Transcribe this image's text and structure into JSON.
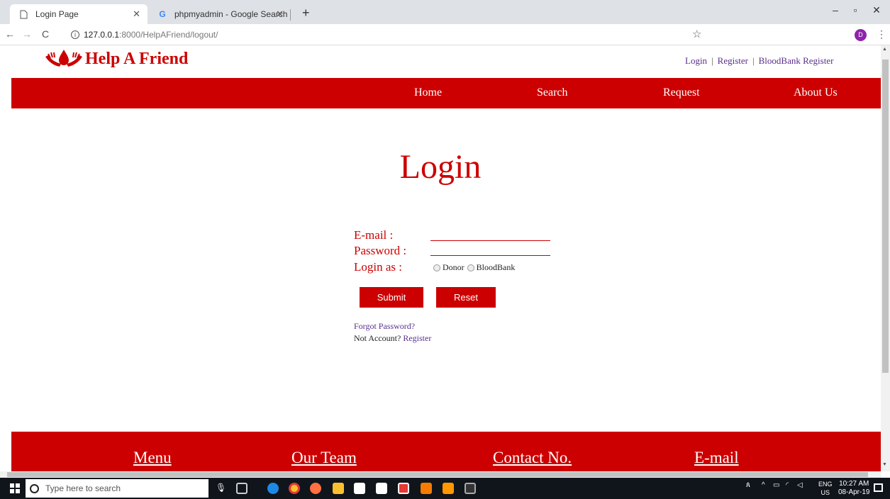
{
  "browser": {
    "tabs": [
      {
        "title": "Login Page",
        "active": true
      },
      {
        "title": "phpmyadmin - Google Search",
        "active": false
      }
    ],
    "url_host": "127.0.0.1",
    "url_path": ":8000/HelpAFriend/logout/",
    "profile_initial": "D"
  },
  "site": {
    "logo_text": "Help A Friend",
    "top_links": [
      "Login",
      "Register",
      "BloodBank Register"
    ],
    "nav": [
      "Home",
      "Search",
      "Request",
      "About Us"
    ]
  },
  "login": {
    "title": "Login",
    "email_label": "E-mail :",
    "password_label": "Password :",
    "login_as_label": "Login as :",
    "roles": [
      "Donor",
      "BloodBank"
    ],
    "submit_label": "Submit",
    "reset_label": "Reset",
    "forgot_label": "Forgot Password?",
    "no_account_text": "Not Account?",
    "register_link": "Register"
  },
  "footer": {
    "links": [
      "Menu",
      "Our Team",
      "Contact No.",
      "E-mail"
    ]
  },
  "taskbar": {
    "search_placeholder": "Type here to search",
    "lang": "ENG",
    "region": "US",
    "time": "10:27 AM",
    "date": "08-Apr-19"
  },
  "colors": {
    "brand_red": "#cc0000",
    "link_purple": "#5b2e8c"
  }
}
